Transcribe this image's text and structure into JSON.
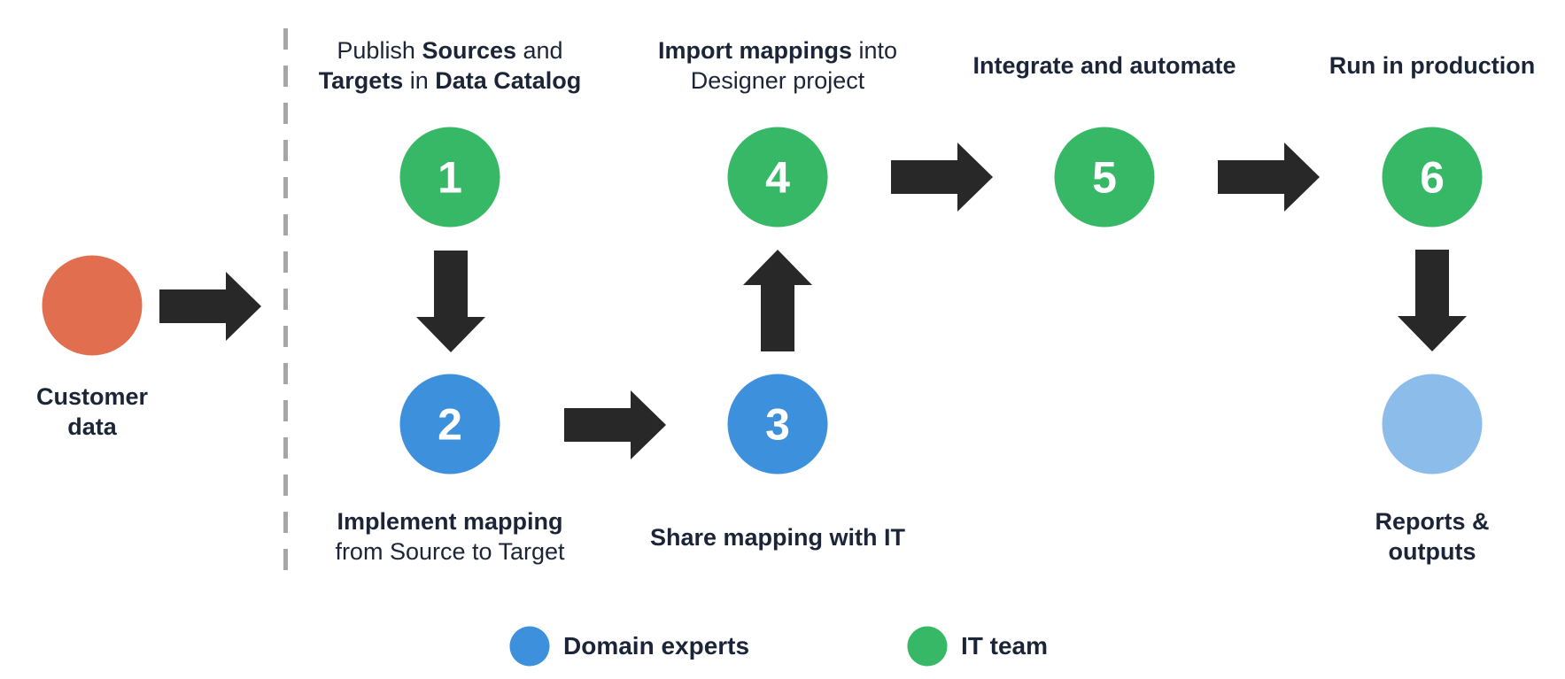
{
  "colors": {
    "it_team": "#37b866",
    "domain_experts": "#3d91dc",
    "customer": "#e06e4f",
    "output": "#8bbcea",
    "arrow": "#282828",
    "divider": "#a6a6a6",
    "text": "#1c2538"
  },
  "source": {
    "label_line1": "Customer",
    "label_line2": "data"
  },
  "steps": [
    {
      "number": "1",
      "team": "it_team",
      "title_parts": [
        [
          {
            "t": "Publish ",
            "b": false
          },
          {
            "t": "Sources",
            "b": true
          },
          {
            "t": " and",
            "b": false
          }
        ],
        [
          {
            "t": "Targets",
            "b": true
          },
          {
            "t": " in ",
            "b": false
          },
          {
            "t": "Data Catalog",
            "b": true
          }
        ]
      ]
    },
    {
      "number": "2",
      "team": "domain_experts",
      "title_parts": [
        [
          {
            "t": "Implement mapping",
            "b": true
          }
        ],
        [
          {
            "t": "from Source to Target",
            "b": false
          }
        ]
      ]
    },
    {
      "number": "3",
      "team": "domain_experts",
      "title_parts": [
        [
          {
            "t": "Share mapping with IT",
            "b": true
          }
        ]
      ]
    },
    {
      "number": "4",
      "team": "it_team",
      "title_parts": [
        [
          {
            "t": "Import mappings",
            "b": true
          },
          {
            "t": " into",
            "b": false
          }
        ],
        [
          {
            "t": "Designer project",
            "b": false
          }
        ]
      ]
    },
    {
      "number": "5",
      "team": "it_team",
      "title_parts": [
        [
          {
            "t": "Integrate and automate",
            "b": true
          }
        ]
      ]
    },
    {
      "number": "6",
      "team": "it_team",
      "title_parts": [
        [
          {
            "t": "Run in production",
            "b": true
          }
        ]
      ]
    }
  ],
  "output": {
    "label_line1": "Reports &",
    "label_line2": "outputs"
  },
  "legend": [
    {
      "label": "Domain experts",
      "team": "domain_experts"
    },
    {
      "label": "IT team",
      "team": "it_team"
    }
  ]
}
